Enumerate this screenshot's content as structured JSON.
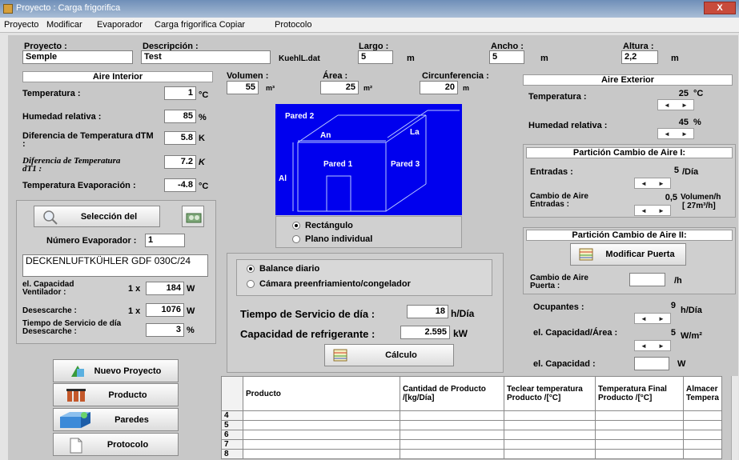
{
  "window": {
    "title": "Proyecto  : Carga frigorifica",
    "close": "X"
  },
  "menu": [
    "Proyecto",
    "Modificar",
    "Evaporador",
    "Carga frigorifica Copiar",
    "Protocolo"
  ],
  "top": {
    "proyecto_label": "Proyecto :",
    "proyecto_value": "Semple",
    "descripcion_label": "Descripción :",
    "descripcion_value": "Test",
    "file_label": "KuehlL.dat",
    "largo_label": "Largo :",
    "largo_value": "5",
    "largo_unit": "m",
    "ancho_label": "Ancho :",
    "ancho_value": "5",
    "ancho_unit": "m",
    "altura_label": "Altura :",
    "altura_value": "2,2",
    "altura_unit": "m"
  },
  "aire_interior": {
    "title": "Aire Interior",
    "temperatura_label": "Temperatura :",
    "temperatura_value": "1",
    "temperatura_unit": "°C",
    "humedad_label": "Humedad relativa :",
    "humedad_value": "85",
    "humedad_unit": "%",
    "dtm_label": "Diferencia de Temperatura dTM",
    "dtm_colon": ":",
    "dtm_value": "5.8",
    "dtm_unit": "K",
    "dtt_label": "Diferencia de Temperatura",
    "dtt_label2": "dT1 :",
    "dtt_value": "7.2",
    "dtt_unit": "K",
    "evap_label": "Temperatura Evaporación :",
    "evap_value": "-4.8",
    "evap_unit": "°C"
  },
  "evaporador": {
    "seleccion_label": "Selección del",
    "numero_label": "Número Evaporador :",
    "numero_value": "1",
    "name_value": "DECKENLUFTKÜHLER GDF 030C/24",
    "cap_vent_label": "el. Capacidad Ventilador :",
    "cap_vent_mult": "1 x",
    "cap_vent_value": "184",
    "cap_vent_unit": "W",
    "desescarche_label": "Desescarche :",
    "desescarche_mult": "1 x",
    "desescarche_value": "1076",
    "desescarche_unit": "W",
    "tiempo_label": "Tiempo de Servicio de día Desescarche :",
    "tiempo_value": "3",
    "tiempo_unit": "%"
  },
  "geometry": {
    "volumen_label": "Volumen :",
    "volumen_value": "55",
    "volumen_unit": "m³",
    "area_label": "Área :",
    "area_value": "25",
    "area_unit": "m²",
    "circ_label": "Circunferencia :",
    "circ_value": "20",
    "circ_unit": "m"
  },
  "diagram": {
    "pared2": "Pared 2",
    "an": "An",
    "la": "La",
    "pared1": "Pared 1",
    "pared3": "Pared 3",
    "al": "Al"
  },
  "shape_options": {
    "rectangulo": "Rectángulo",
    "plano": "Plano individual"
  },
  "balance": {
    "diario": "Balance diario",
    "camara": "Cámara preenfriamiento/congelador",
    "tiempo_label": "Tiempo de Servicio de día :",
    "tiempo_value": "18",
    "tiempo_unit": "h/Día",
    "capacidad_label": "Capacidad de refrigerante :",
    "capacidad_value": "2.595",
    "capacidad_unit": "kW",
    "calculo": "Cálculo"
  },
  "aire_exterior": {
    "title": "Aire Exterior",
    "temperatura_label": "Temperatura :",
    "temperatura_value": "25",
    "temperatura_unit": "°C",
    "humedad_label": "Humedad relativa :",
    "humedad_value": "45",
    "humedad_unit": "%"
  },
  "particion1": {
    "title": "Partición Cambio de Aire I:",
    "entradas_label": "Entradas :",
    "entradas_value": "5",
    "entradas_unit": "/Día",
    "cambio_label": "Cambio de Aire Entradas :",
    "cambio_value": "0,5",
    "cambio_unit": "Volumen/h",
    "cambio_unit2": "[ 27m³/h]"
  },
  "particion2": {
    "title": "Partición Cambio de Aire II:",
    "modificar": "Modificar Puerta",
    "cambio_label": "Cambio de Aire Puerta :",
    "cambio_value": "",
    "cambio_unit": "/h",
    "ocupantes_label": "Ocupantes :",
    "ocupantes_value": "9",
    "ocupantes_unit": "h/Día",
    "cap_area_label": "el. Capacidad/Área :",
    "cap_area_value": "5",
    "cap_area_unit": "W/m²",
    "cap_label": "el. Capacidad :",
    "cap_value": "",
    "cap_unit": "W"
  },
  "buttons": {
    "nuevo": "Nuevo Proyecto",
    "producto": "Producto",
    "paredes": "Paredes",
    "protocolo": "Protocolo"
  },
  "table": {
    "headers": [
      "Producto",
      "Cantidad de Producto /[kg/Día]",
      "Teclear temperatura Producto /[°C]",
      "Temperatura Final Producto /[°C]",
      "Almacer Tempera"
    ],
    "rows": [
      "4",
      "5",
      "6",
      "7",
      "8"
    ]
  }
}
